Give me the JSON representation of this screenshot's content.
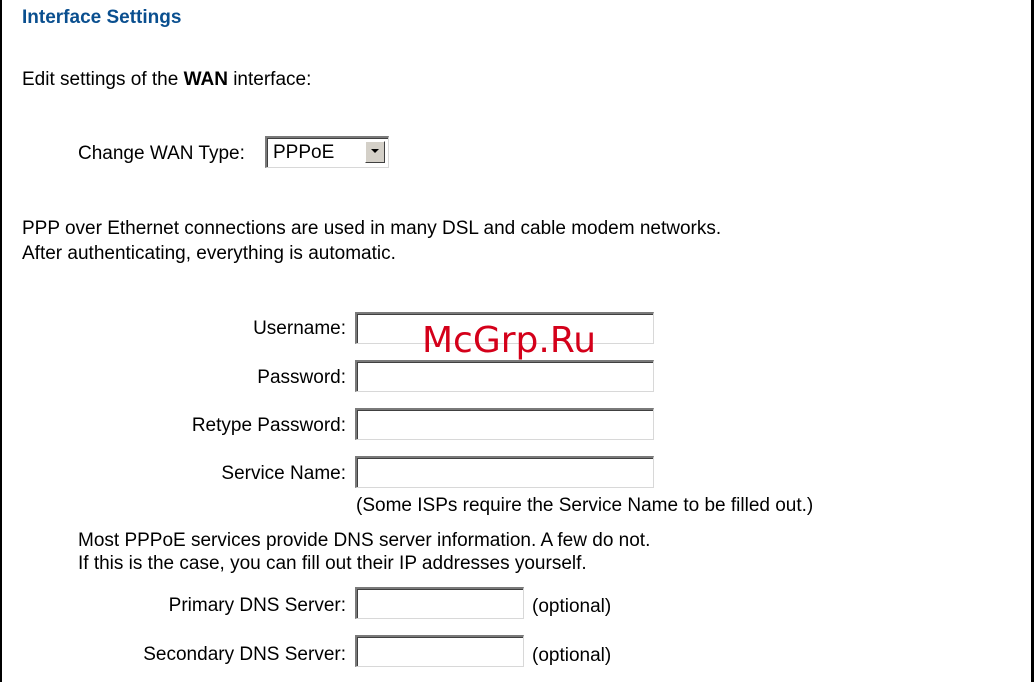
{
  "header": {
    "title": "Interface Settings"
  },
  "intro": {
    "prefix": "Edit settings of the ",
    "interface": "WAN",
    "suffix": " interface:"
  },
  "wan_type": {
    "label": "Change WAN Type:",
    "selected": "PPPoE"
  },
  "description": {
    "line1": "PPP over Ethernet connections are used in many DSL and cable modem networks.",
    "line2": "After authenticating, everything is automatic."
  },
  "form": {
    "username_label": "Username:",
    "username_value": "",
    "password_label": "Password:",
    "password_value": "",
    "retype_label": "Retype Password:",
    "retype_value": "",
    "service_label": "Service Name:",
    "service_value": "",
    "service_note": "(Some ISPs require the Service Name to be filled out.)"
  },
  "dns": {
    "info_line1": "Most PPPoE services provide DNS server information. A few do not.",
    "info_line2": "If this is the case, you can fill out their IP addresses yourself.",
    "primary_label": "Primary DNS Server:",
    "primary_value": "",
    "primary_note": "(optional)",
    "secondary_label": "Secondary DNS Server:",
    "secondary_value": "",
    "secondary_note": "(optional)"
  },
  "watermark": "McGrp.Ru",
  "icons": {
    "select_arrow": "chevron-down-icon"
  },
  "colors": {
    "title": "#0a4f8f",
    "watermark": "#d4001a"
  }
}
